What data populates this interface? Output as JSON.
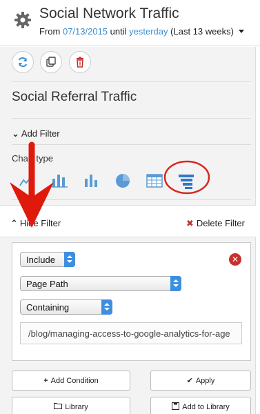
{
  "header": {
    "title": "Social Network Traffic",
    "date_prefix": "From",
    "date_start": "07/13/2015",
    "date_mid": "until",
    "date_end": "yesterday",
    "date_range": "(Last 13 weeks)"
  },
  "toolbar": {
    "refresh_icon": "refresh-icon",
    "copy_icon": "copy-icon",
    "delete_icon": "trash-icon",
    "accent": "#3b8fd0",
    "danger": "#c9302c"
  },
  "report": {
    "title": "Social Referral Traffic",
    "add_filter_label": "Add Filter",
    "chart_type_label": "Chart type",
    "chart_types": [
      "line",
      "stacked-bar",
      "bar",
      "pie",
      "table",
      "funnel"
    ],
    "selected_chart_type": "funnel"
  },
  "filter": {
    "hide_label": "Hide Filter",
    "delete_label": "Delete Filter",
    "include_value": "Include",
    "dimension_value": "Page Path",
    "match_value": "Containing",
    "text_value": "/blog/managing-access-to-google-analytics-for-age"
  },
  "actions": {
    "add_condition": "Add Condition",
    "apply": "Apply",
    "library": "Library",
    "add_to_library": "Add to Library"
  },
  "annotation": {
    "arrow_color": "#e0190d",
    "circle_color": "#d9261c"
  }
}
